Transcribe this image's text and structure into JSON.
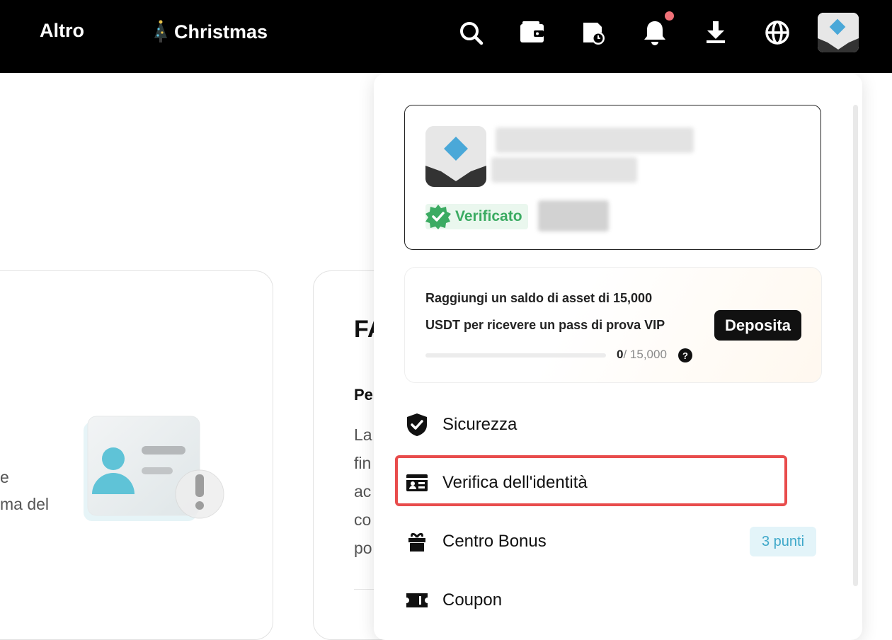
{
  "topbar": {
    "nav_more": "Altro",
    "nav_christmas": "Christmas",
    "icons": [
      "search-icon",
      "wallet-icon",
      "order-history-icon",
      "bell-icon",
      "download-icon",
      "globe-icon"
    ]
  },
  "background": {
    "left_card_lines": [
      "e",
      "ma del"
    ],
    "faq_title": "FA",
    "faq_subtitle": "Pe",
    "faq_lines": [
      "La",
      "fin",
      "ac",
      "co",
      "po"
    ]
  },
  "profile": {
    "verified_label": "Verificato"
  },
  "vip": {
    "line1": "Raggiungi un saldo di asset di 15,000",
    "line2": "USDT per ricevere un pass di prova VIP",
    "progress_current": "0",
    "progress_total": "/ 15,000",
    "progress_fraction": 0,
    "help": "?",
    "deposit_label": "Deposita"
  },
  "menu": {
    "security": "Sicurezza",
    "identity": "Verifica dell'identità",
    "bonus": "Centro Bonus",
    "bonus_points": "3 punti",
    "coupon": "Coupon"
  },
  "colors": {
    "highlight": "#e84c4c",
    "verified": "#3bab62",
    "badge_text": "#3ea8c9",
    "notification_dot": "#f07178",
    "avatar_diamond": "#4aa8d8"
  }
}
